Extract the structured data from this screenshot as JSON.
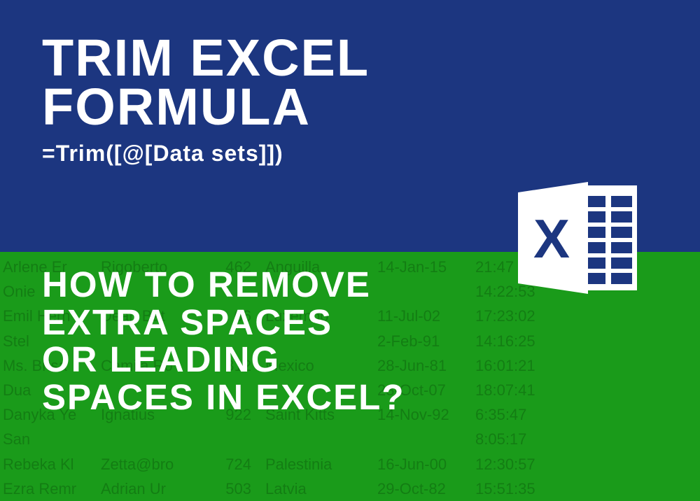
{
  "top": {
    "title_line1": "TRIM EXCEL",
    "title_line2": "FORMULA",
    "formula": "=Trim([@[Data sets]])"
  },
  "bottom": {
    "subtitle_line1": "HOW TO REMOVE",
    "subtitle_line2": "EXTRA SPACES",
    "subtitle_line3": "OR LEADING",
    "subtitle_line4": "SPACES IN EXCEL?"
  },
  "logo": {
    "name": "excel-logo",
    "letter": "X"
  },
  "bg_rows": [
    {
      "c1": "Arlene Er",
      "c2": "Rigoberto",
      "c3": "462",
      "c4": "Anguilla",
      "c5": "14-Jan-15",
      "c6": "21:47"
    },
    {
      "c1": "Onie",
      "c2": "",
      "c3": "",
      "c4": "",
      "c5": "",
      "c6": "14:22:53"
    },
    {
      "c1": "Emil Hern",
      "c2": "Dean Bat",
      "c3": "66",
      "c4": "Luxembo",
      "c5": "11-Jul-02",
      "c6": "17:23:02"
    },
    {
      "c1": "Stel",
      "c2": "",
      "c3": "",
      "c4": "",
      "c5": "2-Feb-91",
      "c6": "14:16:25"
    },
    {
      "c1": "Ms. Brisa",
      "c2": "Camila Ro",
      "c3": "312",
      "c4": "Mexico",
      "c5": "28-Jun-81",
      "c6": "16:01:21"
    },
    {
      "c1": "Dua",
      "c2": "",
      "c3": "",
      "c4": "",
      "c5": "23-Oct-07",
      "c6": "18:07:41"
    },
    {
      "c1": "Danyka Ye",
      "c2": "Ignatius",
      "c3": "922",
      "c4": "Saint Kitts",
      "c5": "14-Nov-92",
      "c6": "6:35:47"
    },
    {
      "c1": "San",
      "c2": "",
      "c3": "",
      "c4": "",
      "c5": "",
      "c6": "8:05:17"
    },
    {
      "c1": "Rebeka Kl",
      "c2": "Zetta@bro",
      "c3": "724",
      "c4": "Palestinia",
      "c5": "16-Jun-00",
      "c6": "12:30:57"
    },
    {
      "c1": "Ezra Remr",
      "c2": "Adrian Ur",
      "c3": "503",
      "c4": "Latvia",
      "c5": "29-Oct-82",
      "c6": "15:51:35"
    }
  ]
}
